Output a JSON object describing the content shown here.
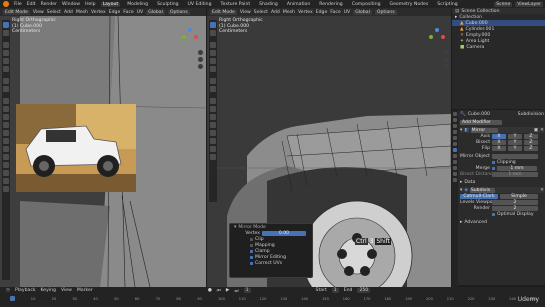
{
  "topbar": {
    "menu": [
      "File",
      "Edit",
      "Render",
      "Window",
      "Help"
    ],
    "workspaces": [
      "Layout",
      "Modeling",
      "Sculpting",
      "UV Editing",
      "Texture Paint",
      "Shading",
      "Animation",
      "Rendering",
      "Compositing",
      "Geometry Nodes",
      "Scripting"
    ],
    "active_workspace": "Layout",
    "scene": "Scene",
    "view_layer": "ViewLayer"
  },
  "left_viewport": {
    "mode": "Edit Mode",
    "menus": [
      "View",
      "Select",
      "Add",
      "Mesh",
      "Vertex",
      "Edge",
      "Face",
      "UV"
    ],
    "transform": "Global",
    "options": "Options",
    "info": [
      "Right Orthographic",
      "(1) Cube.000",
      "Centimeters"
    ]
  },
  "center_viewport": {
    "mode": "Edit Mode",
    "menus": [
      "View",
      "Select",
      "Add",
      "Mesh",
      "Vertex",
      "Edge",
      "Face",
      "UV"
    ],
    "transform": "Global",
    "options": "Options",
    "info": [
      "Right Orthographic",
      "(1) Cube.000",
      "Centimeters"
    ],
    "key_overlay": [
      "Ctrl",
      "3",
      "Shift"
    ]
  },
  "outliner": {
    "title": "Scene Collection",
    "rows": [
      {
        "label": "Collection",
        "selected": false
      },
      {
        "label": "Cube.000",
        "selected": true
      },
      {
        "label": "Cylinder.001",
        "selected": false
      },
      {
        "label": "Empty.000",
        "selected": false
      },
      {
        "label": "Area Light",
        "selected": false
      },
      {
        "label": "Camera",
        "selected": false
      }
    ]
  },
  "properties": {
    "object_name": "Cube.000",
    "modifier_type": "Subdivision",
    "add_modifier": "Add Modifier",
    "mirror": {
      "name": "Mirror",
      "axis_label": "Axis",
      "bisect_label": "Bisect",
      "flip_label": "Flip",
      "axes": [
        "X",
        "Y",
        "Z"
      ],
      "mirror_object_label": "Mirror Object",
      "clipping_label": "Clipping",
      "merge_label": "Merge",
      "merge_value": "1 mm",
      "bisect_distance_label": "Bisect Distance",
      "bisect_distance_value": "1 mm",
      "data_label": "Data"
    },
    "subdivision": {
      "name": "Subdivis",
      "methods": [
        "Catmull-Clark",
        "Simple"
      ],
      "levels_viewport_label": "Levels Viewport",
      "levels_viewport_value": "2",
      "render_label": "Render",
      "render_value": "2",
      "optimal_display_label": "Optimal Display",
      "advanced_label": "Advanced"
    }
  },
  "popup": {
    "title": "Mirror Mode",
    "rows": [
      {
        "label": "Vertex",
        "value": "0.00",
        "type": "field"
      },
      {
        "label": "Clip",
        "checked": false,
        "type": "check"
      },
      {
        "label": "Mapping",
        "checked": false,
        "type": "check"
      },
      {
        "label": "Clamp",
        "checked": true,
        "type": "check"
      },
      {
        "label": "Mirror Editing",
        "checked": true,
        "type": "check"
      },
      {
        "label": "Correct UVs",
        "checked": true,
        "type": "check"
      }
    ]
  },
  "timeline": {
    "menus": [
      "Playback",
      "Keying",
      "View",
      "Marker"
    ],
    "ticks": [
      "0",
      "10",
      "20",
      "30",
      "40",
      "50",
      "60",
      "70",
      "80",
      "90",
      "100",
      "110",
      "120",
      "130",
      "140",
      "150",
      "160",
      "170",
      "180",
      "190",
      "200",
      "210",
      "220",
      "230",
      "240",
      "250"
    ],
    "current_frame": "1",
    "start_label": "Start",
    "start": "1",
    "end_label": "End",
    "end": "250"
  },
  "watermark": "Udemy",
  "colors": {
    "accent": "#4772b3",
    "header": "#2b2b2b",
    "viewport": "#3d3d3d",
    "panel": "#2b2b2b",
    "axis_x": "#e04a4a",
    "axis_y": "#79b32e",
    "axis_z": "#4a8ae0"
  }
}
